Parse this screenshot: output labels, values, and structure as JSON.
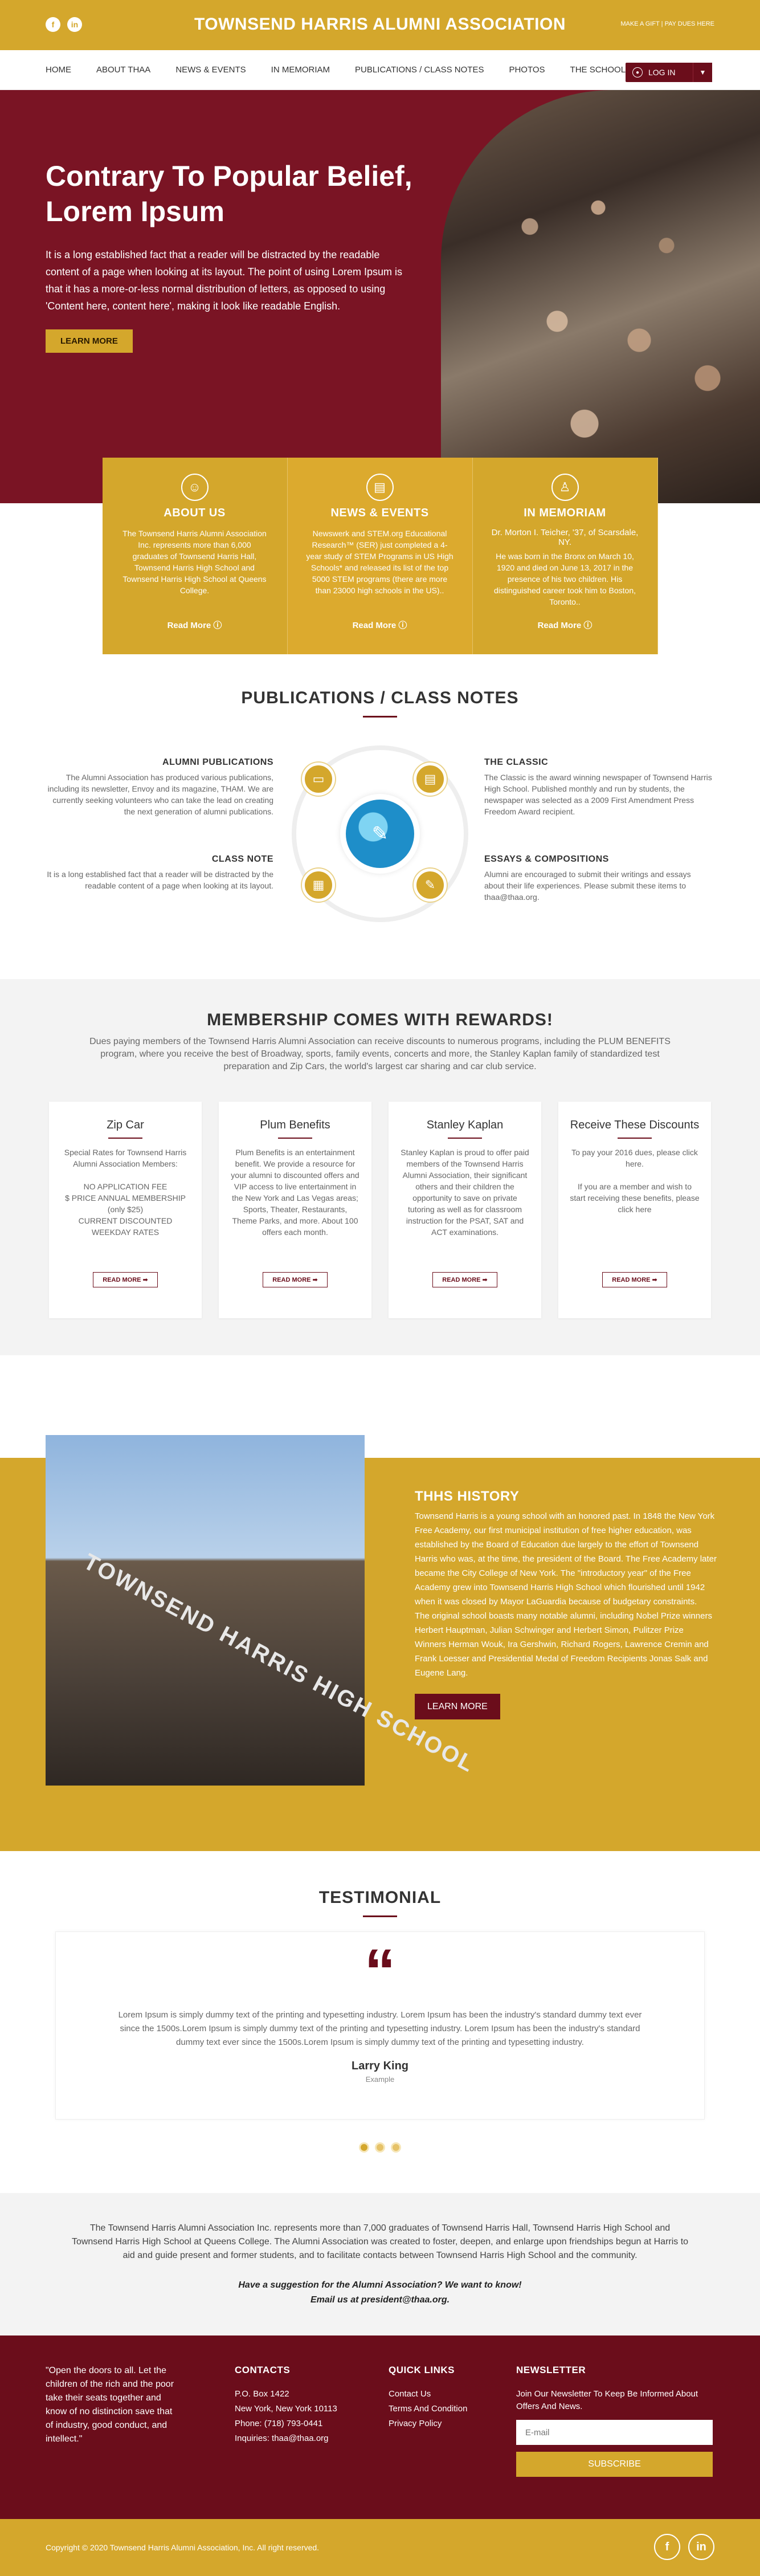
{
  "topbar": {
    "brand": "TOWNSEND HARRIS ALUMNI ASSOCIATION",
    "gift": "MAKE A GIFT | PAY DUES HERE",
    "social": [
      "f",
      "in"
    ]
  },
  "nav": {
    "items": [
      "HOME",
      "ABOUT THAA",
      "NEWS & EVENTS",
      "IN MEMORIAM",
      "PUBLICATIONS / CLASS NOTES",
      "PHOTOS",
      "THE SCHOOL"
    ],
    "login": "LOG IN"
  },
  "hero": {
    "title": "Contrary To Popular Belief, Lorem Ipsum",
    "body": "It is a long established fact that a reader will be distracted by the readable content of a page when looking at its layout. The point of using Lorem Ipsum is that it has a more-or-less normal distribution of letters, as opposed to using 'Content here, content here', making it look like readable English.",
    "button": "LEARN MORE"
  },
  "features": [
    {
      "title": "ABOUT US",
      "sub": "",
      "text": "The Townsend Harris Alumni Association Inc. represents more than 6,000 graduates of Townsend Harris Hall, Townsend Harris High School and Townsend Harris High School at Queens College.",
      "more": "Read More"
    },
    {
      "title": "NEWS &  EVENTS",
      "sub": "",
      "text": "Newswerk and STEM.org Educational Research™ (SER) just completed a 4-year study of STEM Programs in US High Schools* and released its list of the top 5000 STEM programs (there are more than 23000 high schools in the US)..",
      "more": "Read More"
    },
    {
      "title": "IN MEMORIAM",
      "sub": "Dr. Morton I. Teicher, '37, of Scarsdale, NY.",
      "text": "He was born in the Bronx on March 10, 1920 and died on June 13, 2017 in the presence of his two children. His distinguished career took him to Boston, Toronto..",
      "more": "Read More"
    }
  ],
  "publications": {
    "title": "PUBLICATIONS / CLASS NOTES",
    "alumni": {
      "title": "ALUMNI PUBLICATIONS",
      "text": "The Alumni Association has produced various publications, including its newsletter, Envoy and its magazine, THAM. We are currently seeking volunteers who can take the lead on creating the next generation of alumni publications."
    },
    "classic": {
      "title": "THE CLASSIC",
      "text": "The Classic is the award winning newspaper of Townsend Harris High School. Published monthly and run by students, the newspaper was selected as a 2009 First Amendment Press Freedom Award recipient."
    },
    "classnote": {
      "title": "CLASS NOTE",
      "text": "It is a long established fact that a reader will be distracted by the readable content of a page when looking at its layout."
    },
    "essays": {
      "title": "ESSAYS & COMPOSITIONS",
      "text": "Alumni are encouraged to submit their writings and essays about their life experiences. Please submit these items to thaa@thaa.org."
    }
  },
  "membership": {
    "title": "MEMBERSHIP COMES WITH REWARDS!",
    "intro": "Dues paying members of the Townsend Harris Alumni Association can receive discounts to numerous programs, including the PLUM BENEFITS program, where you receive the best of Broadway, sports, family events, concerts and more, the Stanley Kaplan family of standardized test preparation and Zip Cars, the world's largest car sharing and car club service.",
    "cards": [
      {
        "title": "Zip Car",
        "lines": [
          "Special Rates for Townsend Harris Alumni Association Members:",
          "NO APPLICATION FEE",
          "$ PRICE ANNUAL MEMBERSHIP (only $25)",
          "CURRENT DISCOUNTED WEEKDAY RATES"
        ],
        "button": "READ MORE ➡"
      },
      {
        "title": "Plum Benefits",
        "lines": [
          "Plum Benefits is an entertainment benefit. We provide a resource for your alumni to discounted offers and VIP access to live entertainment in the New York and Las Vegas areas; Sports, Theater, Restaurants, Theme Parks, and more. About 100 offers each month."
        ],
        "button": "READ MORE ➡"
      },
      {
        "title": "Stanley Kaplan",
        "lines": [
          "Stanley Kaplan is proud to offer paid members of the Townsend Harris Alumni Association, their significant others and their children the opportunity to save on private tutoring as well as for classroom instruction for the PSAT, SAT and ACT examinations."
        ],
        "button": "READ MORE ➡"
      },
      {
        "title": "Receive These Discounts",
        "lines": [
          "To pay your 2016 dues, please click here.",
          "If you are a member and wish to start receiving these benefits, please click here"
        ],
        "button": "READ MORE ➡"
      }
    ]
  },
  "history": {
    "sign": "TOWNSEND HARRIS HIGH SCHOOL",
    "title": "THHS HISTORY",
    "p1": "Townsend Harris is a young school with an honored past. In 1848 the New York Free Academy, our first municipal institution of free higher education, was established by the Board of Education due largely to the effort of Townsend Harris who was, at the time, the president of the Board. The Free Academy later became the City College of New York. The \"introductory year\" of the Free Academy grew into Townsend Harris High School which flourished until 1942 when it was closed by Mayor LaGuardia because of budgetary constraints.",
    "p2": "The original school boasts many notable alumni, including Nobel Prize winners Herbert Hauptman, Julian Schwinger and Herbert Simon, Pulitzer Prize Winners Herman Wouk, Ira Gershwin, Richard Rogers, Lawrence Cremin and Frank Loesser and Presidential Medal of Freedom Recipients Jonas Salk and Eugene Lang.",
    "button": "LEARN MORE"
  },
  "testimonial": {
    "title": "TESTIMONIAL",
    "quote": "Lorem Ipsum is simply dummy text of the printing and typesetting industry. Lorem Ipsum has been the industry's standard dummy text ever since the 1500s.Lorem Ipsum is simply dummy text of the printing and typesetting industry. Lorem Ipsum has been the industry's standard dummy text ever since the 1500s.Lorem Ipsum is simply dummy text of the printing and typesetting industry.",
    "name": "Larry King",
    "role": "Example"
  },
  "about": {
    "text": "The Townsend Harris Alumni Association Inc. represents more than 7,000 graduates of Townsend Harris Hall, Townsend Harris High School and Townsend Harris High School at Queens College. The Alumni Association was created to foster, deepen, and enlarge upon friendships begun at Harris to aid and guide present and former students, and to facilitate contacts between Townsend Harris High School and the community.",
    "q1": "Have a suggestion for the Alumni Association? We want to know!",
    "q2": "Email us at president@thaa.org."
  },
  "footer": {
    "quote": "\"Open the doors to all. Let the children of the rich and the poor take their seats together and know of no distinction save that of industry, good conduct, and intellect.\"",
    "contacts": {
      "title": "CONTACTS",
      "lines": [
        "P.O. Box 1422",
        "New York, New York 10113",
        "Phone: (718) 793-0441",
        "Inquiries: thaa@thaa.org"
      ]
    },
    "links": {
      "title": "QUICK LINKS",
      "items": [
        "Contact Us",
        "Terms And Condition",
        "Privacy Policy"
      ]
    },
    "newsletter": {
      "title": "NEWSLETTER",
      "text": "Join Our Newsletter To Keep Be Informed About Offers And News.",
      "placeholder": "E-mail",
      "button": "SUBSCRIBE"
    },
    "copyright": "Copyright © 2020 Townsend Harris Alumni Association, Inc. All right reserved.",
    "social": [
      "f",
      "in"
    ]
  }
}
